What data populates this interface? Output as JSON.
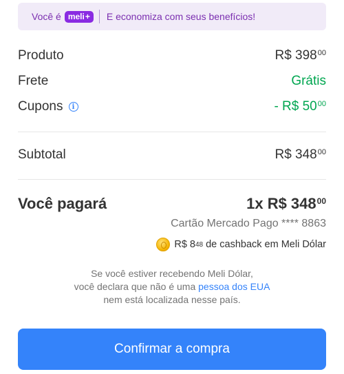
{
  "banner": {
    "prefix": "Você é",
    "badge": "meli",
    "badge_plus": "+",
    "message": "E economiza com seus benefícios!"
  },
  "summary": {
    "produto": {
      "label": "Produto",
      "amount": "R$ 398",
      "cents": "00"
    },
    "frete": {
      "label": "Frete",
      "value": "Grátis"
    },
    "cupons": {
      "label": "Cupons",
      "amount": "- R$ 50",
      "cents": "00"
    },
    "subtotal": {
      "label": "Subtotal",
      "amount": "R$ 348",
      "cents": "00"
    }
  },
  "total": {
    "label": "Você pagará",
    "amount": "1x R$ 348",
    "cents": "00",
    "card": "Cartão Mercado Pago **** 8863"
  },
  "cashback": {
    "amount": "R$ 8",
    "cents": "48",
    "text": "de cashback em Meli Dólar"
  },
  "disclaimer": {
    "line1": "Se você estiver recebendo Meli Dólar,",
    "line2_a": "você declara que não é uma ",
    "link": "pessoa dos EUA",
    "line3": "nem está localizada nesse país."
  },
  "actions": {
    "confirm": "Confirmar a compra"
  },
  "colors": {
    "accent": "#3483fa",
    "green": "#00a650",
    "purple": "#8a2be2"
  }
}
